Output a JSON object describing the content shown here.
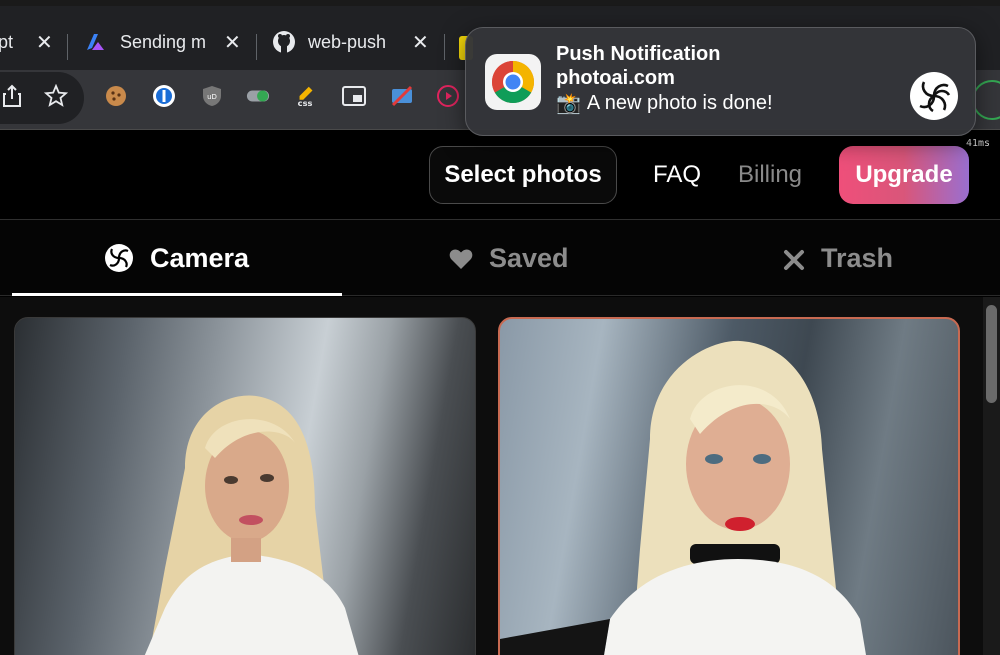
{
  "browser": {
    "tabs": [
      {
        "label": "pt",
        "icon": "tab-partial"
      },
      {
        "label": "Sending m",
        "icon": "azure-icon"
      },
      {
        "label": "web-push",
        "icon": "github-icon"
      }
    ],
    "timing": "41ms",
    "toolbar_icons": [
      "share-icon",
      "bookmark-star-icon",
      "cookie-extension-icon",
      "onepassword-extension-icon",
      "ublock-extension-icon",
      "toggle-extension-icon",
      "css-extension-icon",
      "picture-in-picture-extension-icon",
      "blocker-extension-icon",
      "record-extension-icon"
    ]
  },
  "header": {
    "select_photos": "Select photos",
    "faq": "FAQ",
    "billing": "Billing",
    "upgrade": "Upgrade"
  },
  "tabs": [
    {
      "label": "Camera",
      "icon": "camera-spiral-icon",
      "active": true
    },
    {
      "label": "Saved",
      "icon": "heart-icon",
      "active": false
    },
    {
      "label": "Trash",
      "icon": "x-icon",
      "active": false
    }
  ],
  "photos": [
    {
      "id": "photo-1",
      "selected": false
    },
    {
      "id": "photo-2",
      "selected": true
    }
  ],
  "notification": {
    "title": "Push Notification",
    "site": "photoai.com",
    "emoji": "📸",
    "message": "A new photo is done!",
    "app_icon": "chrome-icon",
    "site_icon": "photoai-logo-icon"
  },
  "colors": {
    "upgrade_gradient_start": "#ef4f7a",
    "upgrade_gradient_end": "#9a6fd0",
    "selected_border": "#c86a52"
  }
}
